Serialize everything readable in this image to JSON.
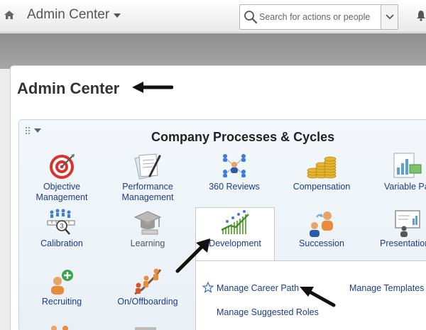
{
  "header": {
    "app_title": "Admin Center",
    "search_placeholder": "Search for actions or people"
  },
  "page": {
    "title": "Admin Center"
  },
  "portlet": {
    "title": "Company Processes & Cycles",
    "tiles": [
      {
        "label": "Objective\nManagement",
        "icon": "target-icon"
      },
      {
        "label": "Performance\nManagement",
        "icon": "document-pen-icon"
      },
      {
        "label": "360 Reviews",
        "icon": "people-network-icon"
      },
      {
        "label": "Compensation",
        "icon": "coins-icon"
      },
      {
        "label": "Variable Pa",
        "icon": "chart-document-icon"
      },
      {
        "label": "Calibration",
        "icon": "calibration-icon"
      },
      {
        "label": "Learning",
        "icon": "graduation-cap-icon"
      },
      {
        "label": "Development",
        "icon": "growth-chart-icon"
      },
      {
        "label": "Succession",
        "icon": "succession-people-icon"
      },
      {
        "label": "Presentation",
        "icon": "presentation-board-icon"
      },
      {
        "label": "Recruiting",
        "icon": "add-person-icon"
      },
      {
        "label": "On/Offboarding",
        "icon": "climbing-people-icon"
      }
    ]
  },
  "flyout": {
    "links": [
      {
        "label": "Manage Career Path"
      },
      {
        "label": "Manage Templates"
      },
      {
        "label": "Manage Suggested Roles"
      }
    ]
  },
  "colors": {
    "link": "#1a3c8a",
    "accent_green": "#6ab04c",
    "target_red": "#d9342b"
  }
}
